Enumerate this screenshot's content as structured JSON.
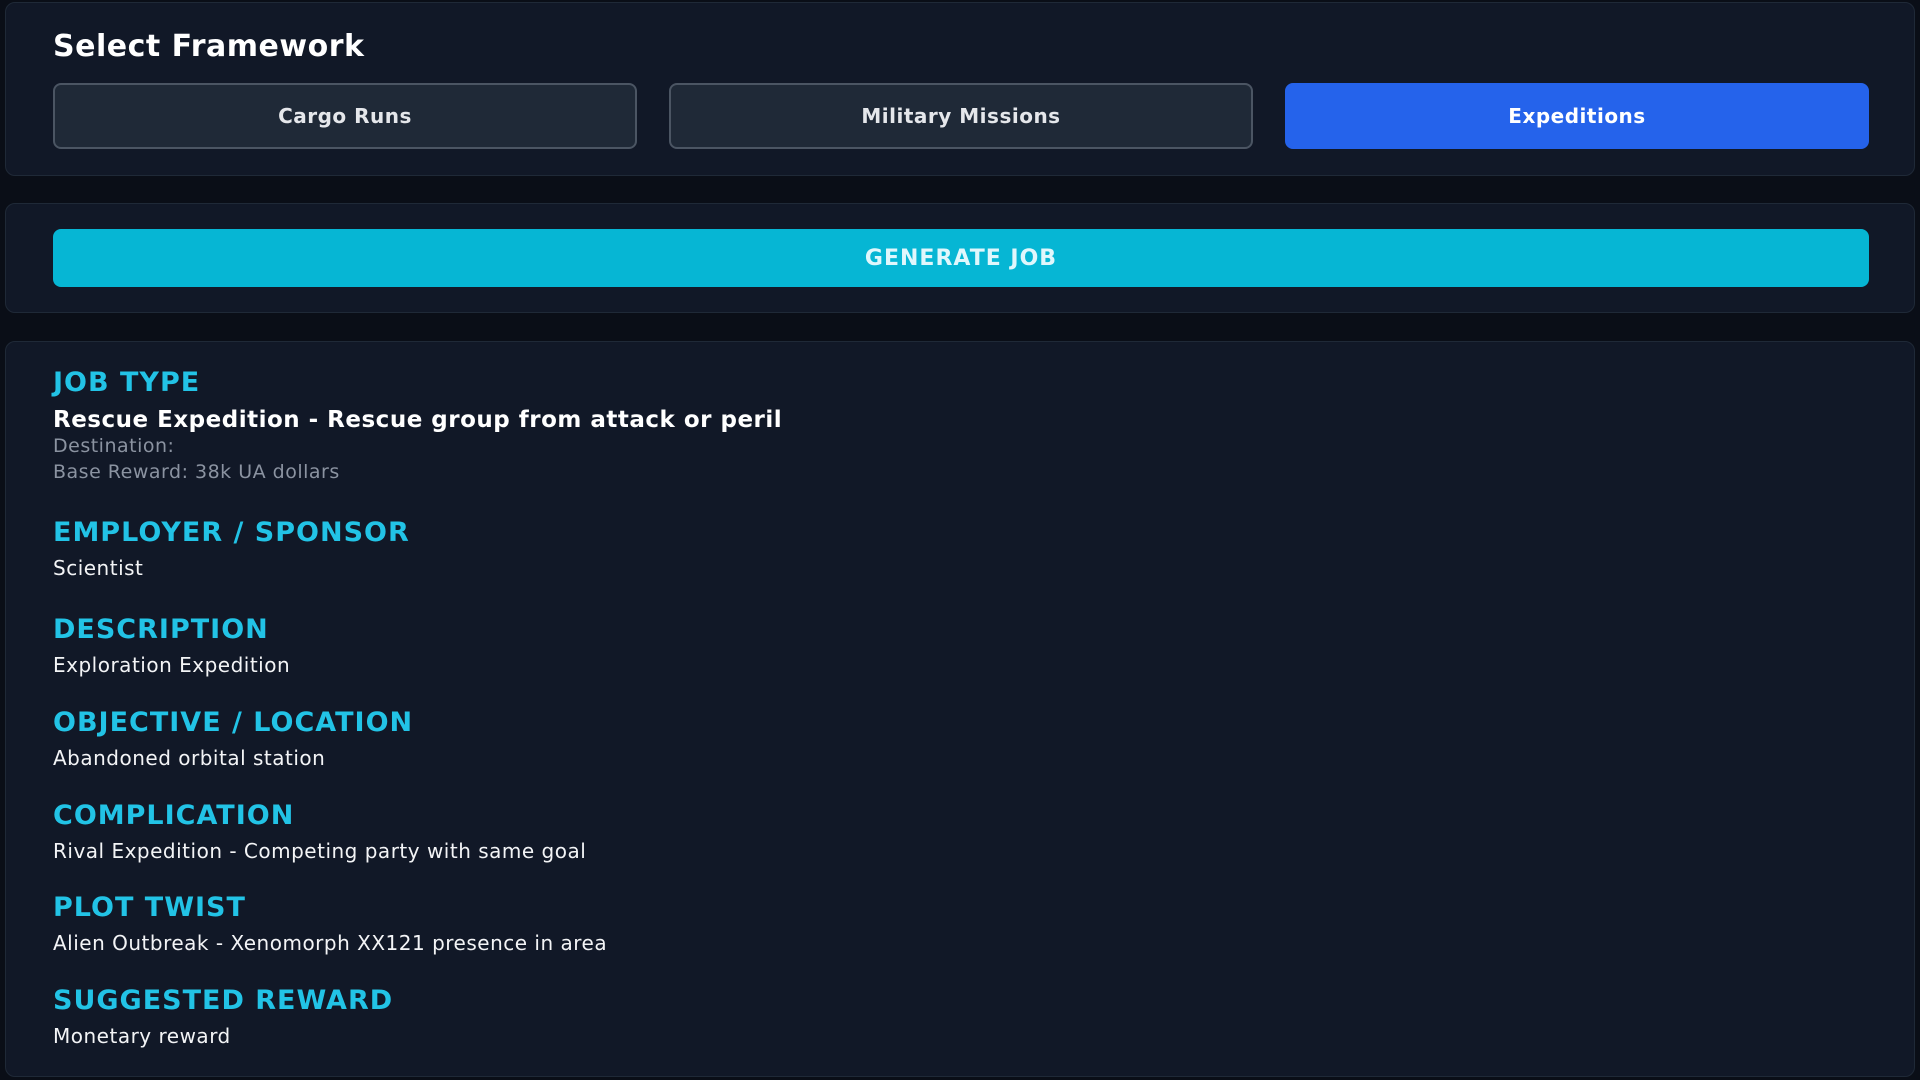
{
  "framework": {
    "title": "Select Framework",
    "options": [
      {
        "label": "Cargo Runs",
        "active": false
      },
      {
        "label": "Military Missions",
        "active": false
      },
      {
        "label": "Expeditions",
        "active": true
      }
    ]
  },
  "generate": {
    "label": "GENERATE JOB"
  },
  "result": {
    "job_type": {
      "label": "JOB TYPE",
      "value": "Rescue Expedition - Rescue group from attack or peril",
      "destination": "Destination:",
      "base_reward": "Base Reward: 38k UA dollars"
    },
    "employer": {
      "label": "EMPLOYER / SPONSOR",
      "value": "Scientist"
    },
    "description": {
      "label": "DESCRIPTION",
      "value": "Exploration Expedition"
    },
    "objective": {
      "label": "OBJECTIVE / LOCATION",
      "value": "Abandoned orbital station"
    },
    "complication": {
      "label": "COMPLICATION",
      "value": "Rival Expedition - Competing party with same goal"
    },
    "plot_twist": {
      "label": "PLOT TWIST",
      "value": "Alien Outbreak - Xenomorph XX121 presence in area"
    },
    "reward": {
      "label": "SUGGESTED REWARD",
      "value": "Monetary reward"
    }
  },
  "colors": {
    "background": "#0a0e17",
    "panel": "#111827",
    "active_button": "#2563eb",
    "generate_button": "#06b6d4",
    "label_accent": "#22c3e6"
  }
}
